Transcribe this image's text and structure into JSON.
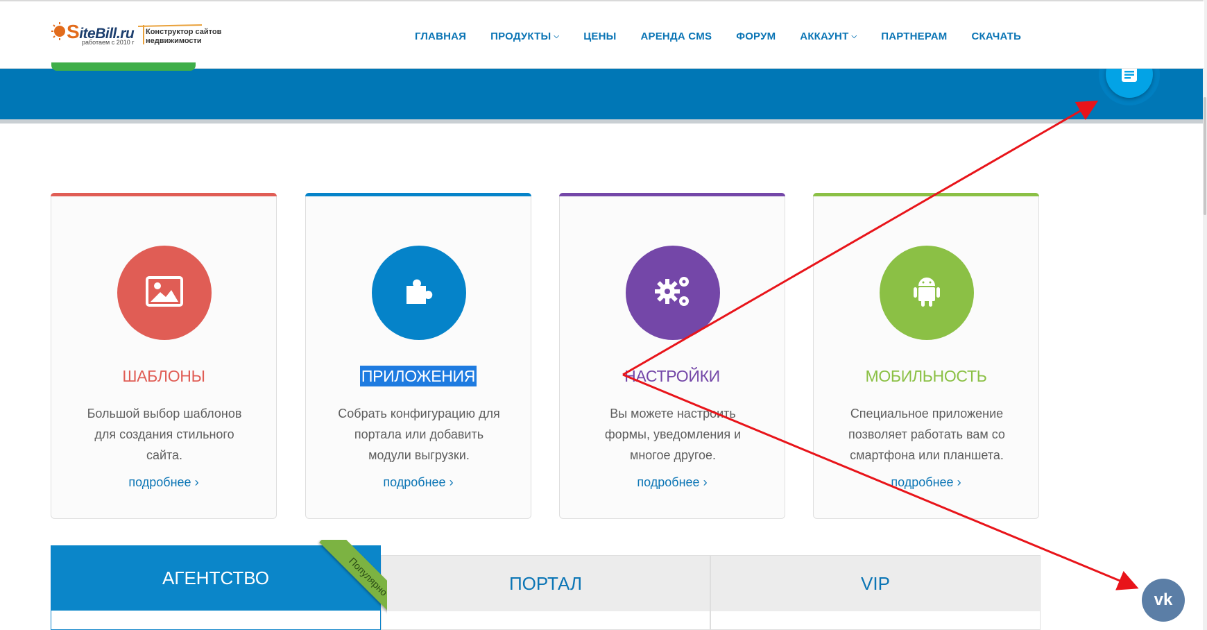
{
  "header": {
    "logo": {
      "brand_rest": "iteBill.ru",
      "brand_s": "S",
      "since": "работаем с 2010 г",
      "tagline_line1": "Конструктор сайтов",
      "tagline_line2": "недвижимости"
    },
    "nav": [
      {
        "label": "ГЛАВНАЯ",
        "dropdown": false
      },
      {
        "label": "ПРОДУКТЫ",
        "dropdown": true
      },
      {
        "label": "ЦЕНЫ",
        "dropdown": false
      },
      {
        "label": "АРЕНДА CMS",
        "dropdown": false
      },
      {
        "label": "ФОРУМ",
        "dropdown": false
      },
      {
        "label": "АККАУНТ",
        "dropdown": true
      },
      {
        "label": "ПАРТНЕРАМ",
        "dropdown": false
      },
      {
        "label": "СКАЧАТЬ",
        "dropdown": false
      }
    ]
  },
  "features": [
    {
      "title": "ШАБЛОНЫ",
      "description": "Большой выбор шаблонов для создания стильного сайта.",
      "more": "подробнее",
      "color": "#e05d55",
      "icon": "image-icon"
    },
    {
      "title": "ПРИЛОЖЕНИЯ",
      "description": "Собрать конфигурацию для портала или добавить модули выгрузки.",
      "more": "подробнее",
      "color": "#0583c9",
      "icon": "puzzle-icon"
    },
    {
      "title": "НАСТРОЙКИ",
      "description": "Вы можете настроить формы, уведомления и многое другое.",
      "more": "подробнее",
      "color": "#7447a8",
      "icon": "gears-icon"
    },
    {
      "title": "МОБИЛЬНОСТЬ",
      "description": "Специальное приложение позволяет работать вам со смартфона или планшета.",
      "more": "подробнее",
      "color": "#8bc045",
      "icon": "android-icon"
    }
  ],
  "pricing": [
    {
      "name": "АГЕНТСТВО",
      "featured": true
    },
    {
      "name": "ПОРТАЛ",
      "featured": false
    },
    {
      "name": "VIP",
      "featured": false
    }
  ],
  "ribbon": "Популярно",
  "colors": {
    "band_blue": "#0077b6",
    "nav_blue": "#0b75b5",
    "fab_blue": "#03a3e6",
    "vk_blue": "#5b7ea6",
    "annotation_red": "#e8141a",
    "highlight": "#1e7be0"
  },
  "floating": {
    "feedback_icon": "document-icon",
    "vk_icon": "vk-icon",
    "vk_label": "vk"
  }
}
